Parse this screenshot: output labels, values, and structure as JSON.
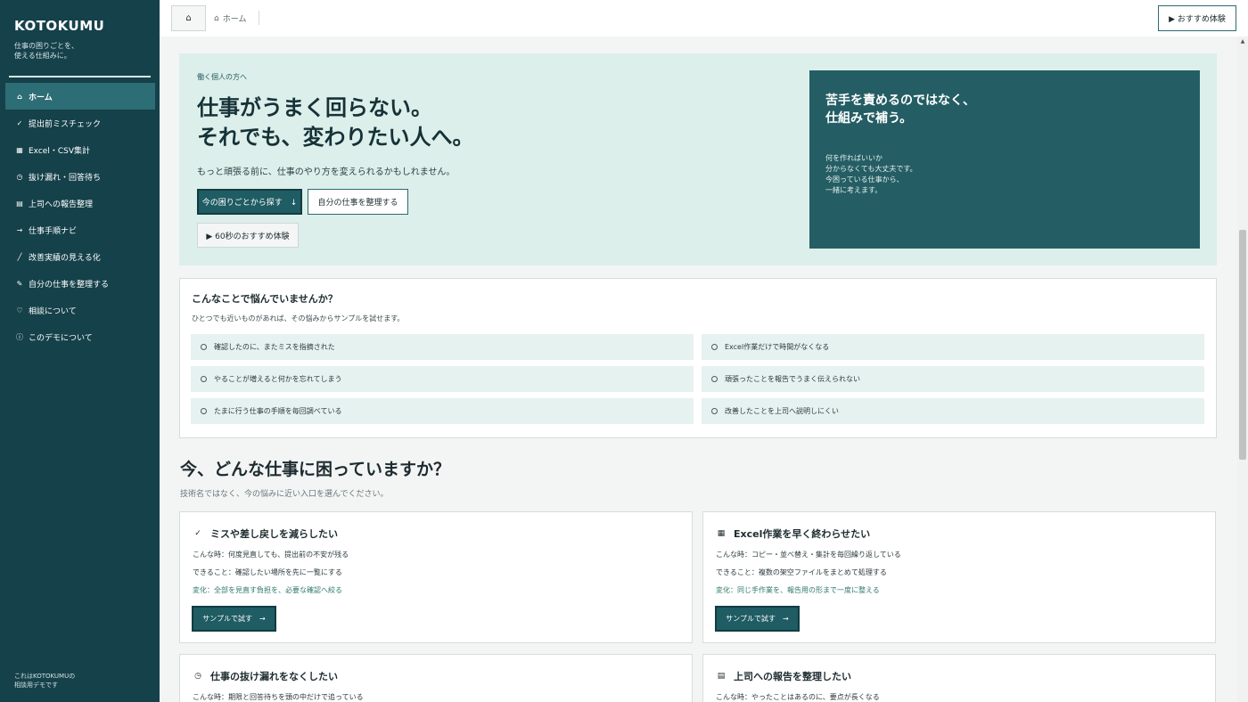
{
  "sidebar": {
    "brand": "KOTOKUMU",
    "tagline": "仕事の困りごとを、\n使える仕組みに。",
    "items": [
      {
        "icon": "⌂",
        "icon_name": "home-icon",
        "label": "ホーム"
      },
      {
        "icon": "✓",
        "icon_name": "check-icon",
        "label": "提出前ミスチェック"
      },
      {
        "icon": "▦",
        "icon_name": "table-icon",
        "label": "Excel・CSV集計"
      },
      {
        "icon": "◷",
        "icon_name": "clock-icon",
        "label": "抜け漏れ・回答待ち"
      },
      {
        "icon": "▤",
        "icon_name": "report-icon",
        "label": "上司への報告整理"
      },
      {
        "icon": "→",
        "icon_name": "arrow-right-icon",
        "label": "仕事手順ナビ"
      },
      {
        "icon": "╱",
        "icon_name": "chart-line-icon",
        "label": "改善実績の見える化"
      },
      {
        "icon": "✎",
        "icon_name": "pencil-icon",
        "label": "自分の仕事を整理する"
      },
      {
        "icon": "♡",
        "icon_name": "heart-icon",
        "label": "相談について"
      },
      {
        "icon": "ⓘ",
        "icon_name": "info-icon",
        "label": "このデモについて"
      }
    ],
    "footer": "これはKOTOKUMUの\n相談用デモです"
  },
  "topbar": {
    "home_icon": "⌂",
    "breadcrumb_icon": "⌂",
    "breadcrumb": "ホーム",
    "demo_button": "▶ おすすめ体験"
  },
  "hero": {
    "eyebrow": "働く個人の方へ",
    "title": "仕事がうまく回らない。\nそれでも、変わりたい人へ。",
    "subtitle": "もっと頑張る前に、仕事のやり方を変えられるかもしれません。",
    "primary_button": "今の困りごとから探す　↓",
    "secondary_button": "自分の仕事を整理する",
    "tertiary_button": "▶ 60秒のおすすめ体験",
    "card_title": "苦手を責めるのではなく、\n仕組みで補う。",
    "card_body": "何を作ればいいか\n分からなくても大丈夫です。\n今困っている仕事から、\n一緒に考えます。"
  },
  "worries": {
    "title": "こんなことで悩んでいませんか？",
    "subtitle": "ひとつでも近いものがあれば、その悩みからサンプルを試せます。",
    "items": [
      "確認したのに、またミスを指摘された",
      "Excel作業だけで時間がなくなる",
      "やることが増えると何かを忘れてしまう",
      "頑張ったことを報告でうまく伝えられない",
      "たまに行う仕事の手順を毎回調べている",
      "改善したことを上司へ説明しにくい"
    ]
  },
  "section": {
    "title": "今、どんな仕事に困っていますか？",
    "subtitle": "技術名ではなく、今の悩みに近い入口を選んでください。"
  },
  "cards": [
    {
      "icon": "✓",
      "icon_name": "check-icon",
      "title": "ミスや差し戻しを減らしたい",
      "when": "こんな時：何度見直しても、提出前の不安が残る",
      "can": "できること：確認したい場所を先に一覧にする",
      "change": "変化：全部を見直す負担を、必要な確認へ絞る",
      "button": "サンプルで試す　→"
    },
    {
      "icon": "▦",
      "icon_name": "table-icon",
      "title": "Excel作業を早く終わらせたい",
      "when": "こんな時：コピー・並べ替え・集計を毎回繰り返している",
      "can": "できること：複数の架空ファイルをまとめて処理する",
      "change": "変化：同じ手作業を、報告用の形まで一度に整える",
      "button": "サンプルで試す　→"
    },
    {
      "icon": "◷",
      "icon_name": "clock-icon",
      "title": "仕事の抜け漏れをなくしたい",
      "when": "こんな時：期限と回答待ちを頭の中だけで追っている"
    },
    {
      "icon": "▤",
      "icon_name": "report-icon",
      "title": "上司への報告を整理したい",
      "when": "こんな時：やったことはあるのに、要点が長くなる"
    }
  ]
}
